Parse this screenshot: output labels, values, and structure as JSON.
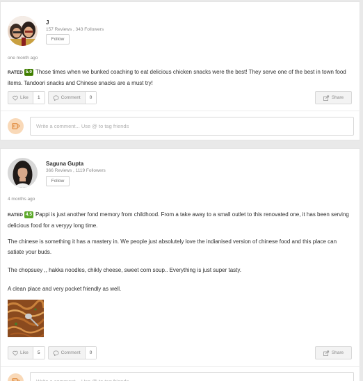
{
  "reviews": [
    {
      "user_name": "J",
      "user_stats": "157 Reviews , 343 Followers",
      "follow_label": "Follow",
      "time": "one month ago",
      "rated_label": "RATED",
      "rating": "5.0",
      "rating_color": "#3f7e00",
      "paragraphs": [
        "Those times when we bunked coaching to eat delicious chicken snacks were the best! They serve one of the best in town food items. Tandoori snacks and Chinese snacks are a must try!"
      ],
      "like_label": "Like",
      "like_count": "1",
      "comment_label": "Comment",
      "comment_count": "0",
      "share_label": "Share",
      "comment_placeholder": "Write a comment... Use @ to tag friends"
    },
    {
      "user_name": "Saguna Gupta",
      "user_stats": "366 Reviews , 1119 Followers",
      "follow_label": "Follow",
      "time": "4 months ago",
      "rated_label": "RATED",
      "rating": "4.5",
      "rating_color": "#5ba829",
      "paragraphs": [
        "Pappi is just another fond memory from childhood. From a take away to a small outlet to this renovated one, it has been serving delicious food for a veryyy long time.",
        "The chinese is something it has a mastery in. We people just absolutely love the indianised version of chinese food and this place can satiate your buds.",
        "The chopsuey ,, hakka noodles, chikly cheese, sweet corn soup.. Everything is just super tasty.",
        "A clean place and very pocket friendly as well."
      ],
      "like_label": "Like",
      "like_count": "5",
      "comment_label": "Comment",
      "comment_count": "0",
      "share_label": "Share",
      "comment_placeholder": "Write a comment... Use @ to tag friends"
    }
  ],
  "icons": {
    "like": "heart-icon",
    "comment": "speech-bubble-icon",
    "share": "share-icon",
    "user": "coffee-cup-icon"
  }
}
